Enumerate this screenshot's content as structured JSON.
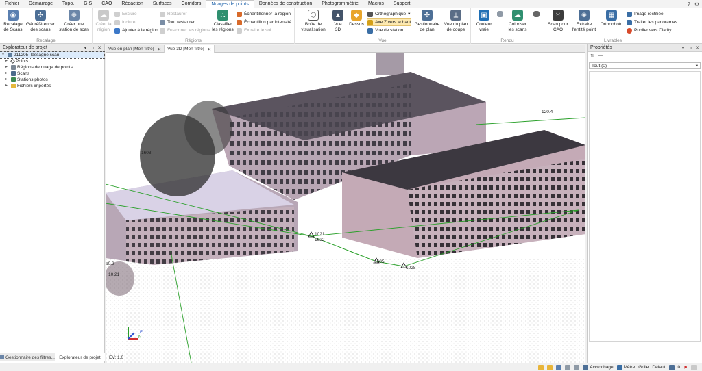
{
  "menu": {
    "items": [
      "Fichier",
      "Démarrage",
      "Topo.",
      "GIS",
      "CAO",
      "Rédaction",
      "Surfaces",
      "Corridors",
      "Nuages de points",
      "Données de construction",
      "Photogrammétrie",
      "Macros",
      "Support"
    ],
    "active": "Nuages de points"
  },
  "ribbon": {
    "recalage": {
      "label": "Recalage",
      "scan_btn": "Recalage\nde Scans",
      "geo_btn": "Géoréférencer\ndes scans",
      "station_btn": "Créer une\nstation de scan"
    },
    "regions": {
      "label": "Régions",
      "create_btn": "Créer la\nrégion",
      "exclude": "Exclure",
      "include": "Inclure",
      "add_to_region": "Ajouter à la région",
      "restore": "Restaurer",
      "restore_all": "Tout restaurer",
      "merge": "Fusionner les régions",
      "classify_btn": "Classifier\nles régions",
      "sample_region": "Échantillonner la région",
      "sample_intensity": "Échantillon par intensité",
      "extract_ground": "Extraire le sol"
    },
    "vue": {
      "label": "Vue",
      "box_btn": "Boîte de\nvisualisation",
      "view3d_btn": "Vue\n3D",
      "dessus_btn": "Dessus",
      "ortho": "Orthographique",
      "axis_z": "Axe Z vers le haut",
      "station_view": "Vue de station",
      "plan_btn": "Gestionnaire\nde plan",
      "section_btn": "Vue du plan\nde coupe"
    },
    "rendu": {
      "label": "Rendu",
      "color_btn": "Couleur\nvraie",
      "colorize_btn": "Coloriser\nles scans"
    },
    "livrables": {
      "label": "Livrables",
      "scan_cad_btn": "Scan pour\nCAO",
      "extract_btn": "Extraire\nl'entité point",
      "ortho_btn": "Orthophoto",
      "rectified": "Image rectifiée",
      "panoramas": "Traiter les panoramas",
      "clarity": "Publier vers Clarity"
    }
  },
  "left_panel": {
    "title": "Explorateur de projet",
    "tree": [
      "211205_lassagne scan",
      "Points",
      "Régions de nuage de points",
      "Scans",
      "Stations photos",
      "Fichiers importés"
    ],
    "tabs": [
      "Gestionnaire des filtres...",
      "Explorateur de projet"
    ]
  },
  "doc_tabs": [
    "Vue en plan [Mon filtre]",
    "Vue 3D [Mon filtre]"
  ],
  "viewport": {
    "labels": [
      "120.4",
      "1603",
      "1605",
      "1028",
      "1622",
      "1021",
      "10.21",
      "b0.2"
    ],
    "ev": "EV: 1,0",
    "axis_e": "E",
    "axis_n": "N"
  },
  "right_panel": {
    "title": "Propriétés",
    "filter": "Tout (0)"
  },
  "statusbar": {
    "snap": "Accrochage",
    "unit": "Mètre",
    "grid": "Grille",
    "default": "Défaut",
    "count": "0"
  },
  "colors": {
    "accent": "#1a5fa8",
    "highlight": "#fde9b0",
    "survey_line": "#2aa02a"
  }
}
